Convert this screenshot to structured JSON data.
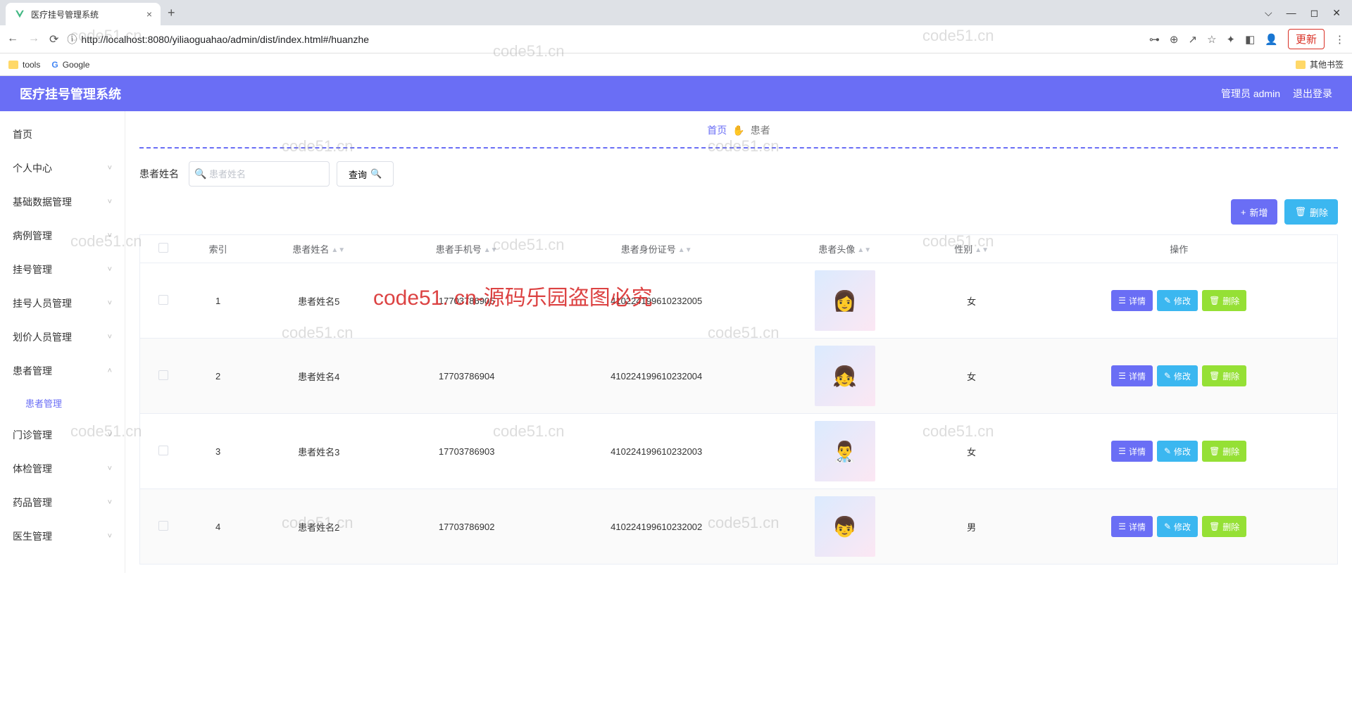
{
  "browser": {
    "tab_title": "医疗挂号管理系统",
    "url": "http://localhost:8080/yiliaoguahao/admin/dist/index.html#/huanzhe",
    "update_label": "更新",
    "bookmarks": {
      "tools": "tools",
      "google": "Google",
      "other": "其他书签"
    }
  },
  "header": {
    "title": "医疗挂号管理系统",
    "user_label": "管理员 admin",
    "logout_label": "退出登录"
  },
  "sidebar": {
    "items": [
      {
        "label": "首页",
        "expandable": false
      },
      {
        "label": "个人中心",
        "expandable": true
      },
      {
        "label": "基础数据管理",
        "expandable": true
      },
      {
        "label": "病例管理",
        "expandable": true
      },
      {
        "label": "挂号管理",
        "expandable": true
      },
      {
        "label": "挂号人员管理",
        "expandable": true
      },
      {
        "label": "划价人员管理",
        "expandable": true
      },
      {
        "label": "患者管理",
        "expandable": true,
        "expanded": true,
        "children": [
          {
            "label": "患者管理"
          }
        ]
      },
      {
        "label": "门诊管理",
        "expandable": true
      },
      {
        "label": "体检管理",
        "expandable": true
      },
      {
        "label": "药品管理",
        "expandable": true
      },
      {
        "label": "医生管理",
        "expandable": true
      }
    ]
  },
  "breadcrumb": {
    "home": "首页",
    "current": "患者"
  },
  "search": {
    "label": "患者姓名",
    "placeholder": "患者姓名",
    "query_label": "查询"
  },
  "actions": {
    "add_label": "新增",
    "delete_label": "删除"
  },
  "table": {
    "columns": {
      "index": "索引",
      "name": "患者姓名",
      "phone": "患者手机号",
      "idcard": "患者身份证号",
      "avatar": "患者头像",
      "gender": "性别",
      "ops": "操作"
    },
    "ops": {
      "detail": "详情",
      "edit": "修改",
      "delete": "删除"
    },
    "rows": [
      {
        "index": "1",
        "name": "患者姓名5",
        "phone": "17703786905",
        "idcard": "410224199610232005",
        "gender": "女",
        "emoji": "👩"
      },
      {
        "index": "2",
        "name": "患者姓名4",
        "phone": "17703786904",
        "idcard": "410224199610232004",
        "gender": "女",
        "emoji": "👧"
      },
      {
        "index": "3",
        "name": "患者姓名3",
        "phone": "17703786903",
        "idcard": "410224199610232003",
        "gender": "女",
        "emoji": "👨‍⚕️"
      },
      {
        "index": "4",
        "name": "患者姓名2",
        "phone": "17703786902",
        "idcard": "410224199610232002",
        "gender": "男",
        "emoji": "👦"
      }
    ]
  },
  "watermark": {
    "grey": "code51.cn",
    "red": "code51. cn-源码乐园盗图必究"
  }
}
